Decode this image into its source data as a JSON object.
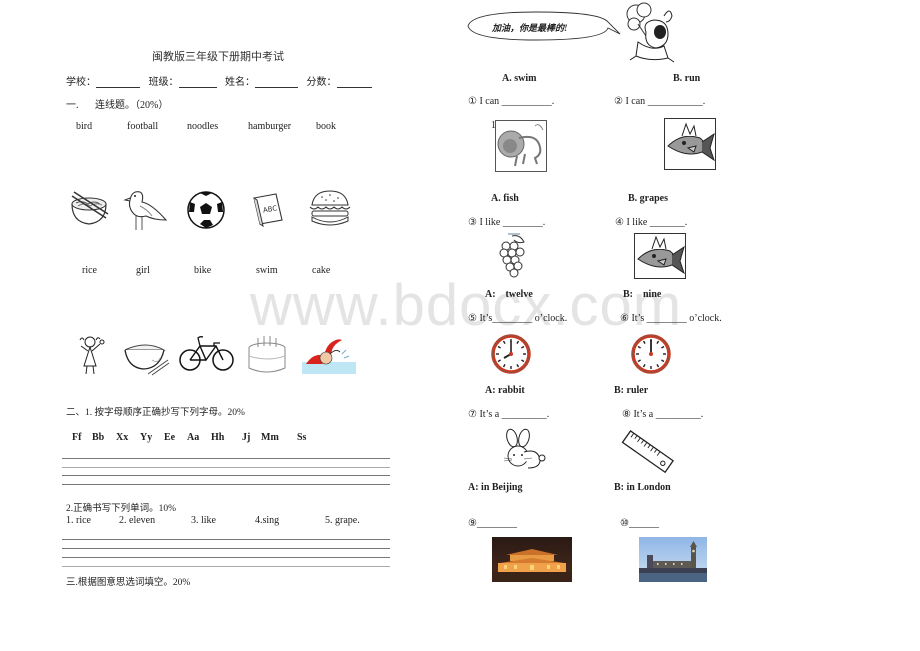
{
  "watermark": "www.bdocx.com",
  "left": {
    "title": "闽教版三年级下册期中考试",
    "info_fields": [
      {
        "label": "学校：",
        "value": "________"
      },
      {
        "label": "班级：",
        "value": "_______"
      },
      {
        "label": "姓名：",
        "value": "________"
      },
      {
        "label": "分数：",
        "value": "______"
      }
    ],
    "section1": {
      "heading_num": "一.",
      "heading_text": "连线题。（20%）",
      "words_row1": [
        "bird",
        "football",
        "noodles",
        "hamburger",
        "book"
      ],
      "pictures_row1": [
        "noodles-bowl",
        "bird",
        "soccer-ball",
        "abc-book",
        "hamburger"
      ],
      "words_row2": [
        "rice",
        "girl",
        "bike",
        "swim",
        "cake"
      ],
      "pictures_row2": [
        "girl",
        "rice-bowl",
        "bicycle",
        "birthday-cake",
        "swimmer"
      ]
    },
    "section2": {
      "heading": "二、1. 按字母顺序正确抄写下列字母。20%",
      "letters": [
        "Ff",
        "Bb",
        "Xx",
        "Yy",
        "Ee",
        "Aa",
        "Hh",
        "Jj",
        "Mm",
        "Ss"
      ],
      "sub_heading": "2.正确书写下列单词。10%",
      "words": [
        "1. rice",
        "2. eleven",
        "3. like",
        "4.sing",
        "5. grape."
      ]
    },
    "section3": {
      "heading": "三.根据图意思选词填空。20%"
    }
  },
  "right": {
    "speech_bubble": "加油，你是最棒的!",
    "q12": {
      "option_a": "A. swim",
      "option_b": "B. run",
      "q1": {
        "num": "①",
        "text": "I can",
        "blank": "__________",
        "end": ".",
        "picture": "lion",
        "picture_label": "1"
      },
      "q2": {
        "num": "②",
        "text": "I can",
        "blank": "___________",
        "end": ".",
        "picture": "fish"
      }
    },
    "q34": {
      "option_a": "A. fish",
      "option_b": "B. grapes",
      "q3": {
        "num": "③",
        "text": "I like",
        "blank": "________",
        "end": ".",
        "picture": "grapes"
      },
      "q4": {
        "num": "④",
        "text": "I like",
        "blank": "_______",
        "end": ".",
        "picture": "fish"
      }
    },
    "q56": {
      "option_a": "A:    twelve",
      "option_b": "B:    nine",
      "q5": {
        "num": "⑤",
        "text": "It’s",
        "blank": "________",
        "end": "o’clock.",
        "picture": "clock-8"
      },
      "q6": {
        "num": "⑥",
        "text": "It’s",
        "blank": "________",
        "end": "o’clock.",
        "picture": "clock-12"
      }
    },
    "q78": {
      "option_a": "A: rabbit",
      "option_b": "B: ruler",
      "q7": {
        "num": "⑦",
        "text": "It’s a",
        "blank": "_________",
        "end": ".",
        "picture": "rabbit"
      },
      "q8": {
        "num": "⑧",
        "text": "It’s a",
        "blank": "_________",
        "end": ".",
        "picture": "ruler"
      }
    },
    "q910": {
      "option_a": "A: in Beijing",
      "option_b": "B: in London",
      "q9": {
        "num": "⑨",
        "blank": "________",
        "picture": "tiananmen-photo"
      },
      "q10": {
        "num": "⑩",
        "blank": "______",
        "picture": "london-photo"
      }
    }
  }
}
